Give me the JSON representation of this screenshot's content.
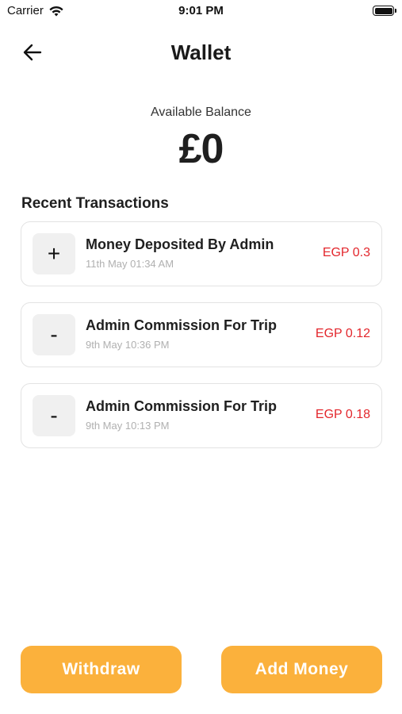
{
  "status_bar": {
    "carrier": "Carrier",
    "time": "9:01 PM",
    "wifi_icon": "wifi-icon",
    "battery_icon": "battery-icon"
  },
  "header": {
    "back_icon": "arrow-left-icon",
    "title": "Wallet"
  },
  "balance": {
    "label": "Available Balance",
    "value": "£0"
  },
  "transactions": {
    "section_title": "Recent Transactions",
    "items": [
      {
        "sign": "+",
        "title": "Money Deposited By Admin",
        "date": "11th May 01:34 AM",
        "amount": "EGP 0.3"
      },
      {
        "sign": "-",
        "title": "Admin Commission For Trip",
        "date": "9th May 10:36 PM",
        "amount": "EGP 0.12"
      },
      {
        "sign": "-",
        "title": "Admin Commission For Trip",
        "date": "9th May 10:13 PM",
        "amount": "EGP 0.18"
      }
    ]
  },
  "actions": {
    "withdraw_label": "Withdraw",
    "add_money_label": "Add Money"
  },
  "colors": {
    "accent": "#fbb13c",
    "amount": "#e3262c",
    "card_border": "#e3e3e3",
    "icon_box": "#f0f0f0"
  }
}
